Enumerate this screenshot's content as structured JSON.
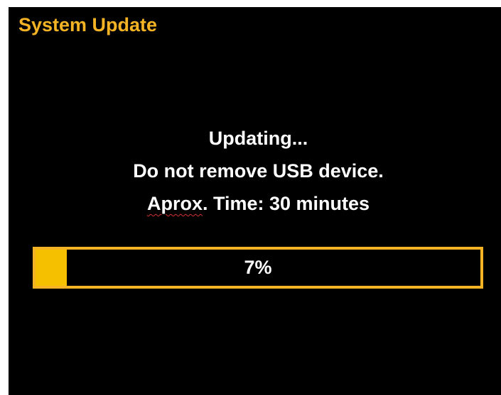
{
  "dialog": {
    "title": "System Update",
    "status_line": "Updating...",
    "warning_line": "Do not remove USB device.",
    "time_prefix": "Aprox",
    "time_suffix": ". Time: 30 minutes"
  },
  "progress": {
    "label": "7%",
    "fraction": 0.07
  },
  "colors": {
    "background": "#000000",
    "accent": "#f3b324",
    "fill": "#f5c000",
    "text": "#ffffff"
  }
}
